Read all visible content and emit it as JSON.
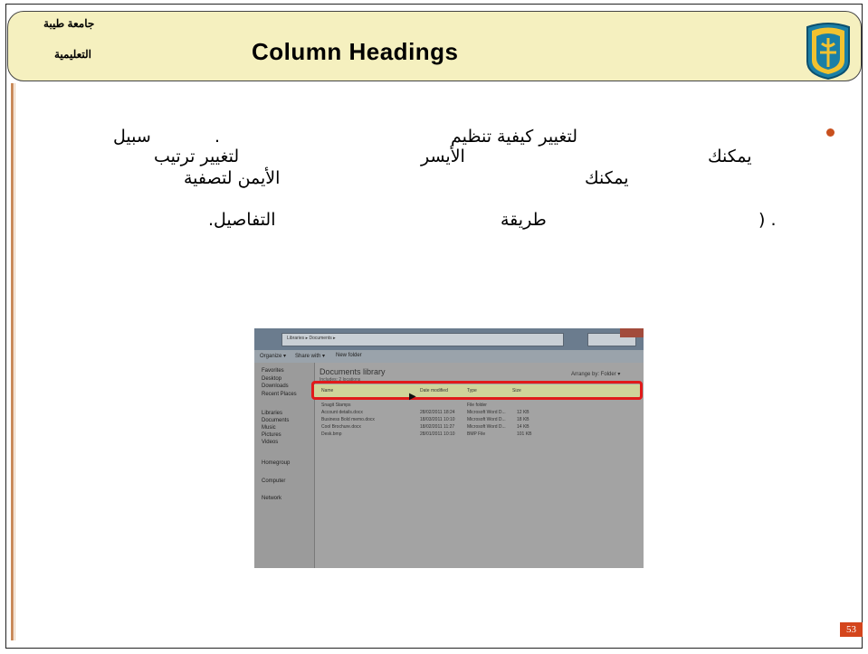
{
  "header": {
    "university_line1": "جامعة طيبة",
    "university_line2": "التعليمية",
    "title": "Column Headings"
  },
  "body_text": {
    "l1a": "لتغيير كيفية تنظيم",
    "l1b": ".",
    "l1c": "سبيل",
    "l2a": "يمكنك",
    "l2b": "الأيسر",
    "l2c": "لتغيير ترتيب",
    "l3a": "يمكنك",
    "l3b": "الأيمن لتصفية",
    "l4a": ". (",
    "l4b": "طريقة",
    "l4c": "التفاصيل."
  },
  "screenshot": {
    "address": "Libraries ▸ Documents ▸",
    "toolbar": [
      "Organize ▾",
      "Share with ▾",
      "New folder"
    ],
    "nav_items": [
      "Favorites",
      "Desktop",
      "Downloads",
      "Recent Places",
      "Libraries",
      "Documents",
      "Music",
      "Pictures",
      "Videos",
      "Homegroup",
      "Computer",
      "Network"
    ],
    "library_title": "Documents library",
    "library_sub": "Includes: 2 locations",
    "arrange": "Arrange by: Folder ▾",
    "columns": [
      "Name",
      "Date modified",
      "Type",
      "Size"
    ],
    "rows": [
      [
        "Snagit Stamps",
        "",
        "File folder",
        ""
      ],
      [
        "Account details.docx",
        "28/02/2011 18:24",
        "Microsoft Word D...",
        "12 KB"
      ],
      [
        "Business Bold memo.docx",
        "18/03/2011 10:10",
        "Microsoft Word D...",
        "18 KB"
      ],
      [
        "Cool Brochure.docx",
        "18/02/2011 11:27",
        "Microsoft Word D...",
        "14 KB"
      ],
      [
        "Desk.bmp",
        "28/01/2011 10:10",
        "BMP File",
        "101 KB"
      ]
    ]
  },
  "page_number": "53",
  "colors": {
    "header_bg": "#f5f0bf",
    "bullet": "#c8501e",
    "highlight": "#e11a1a",
    "page_badge": "#d4451c"
  }
}
